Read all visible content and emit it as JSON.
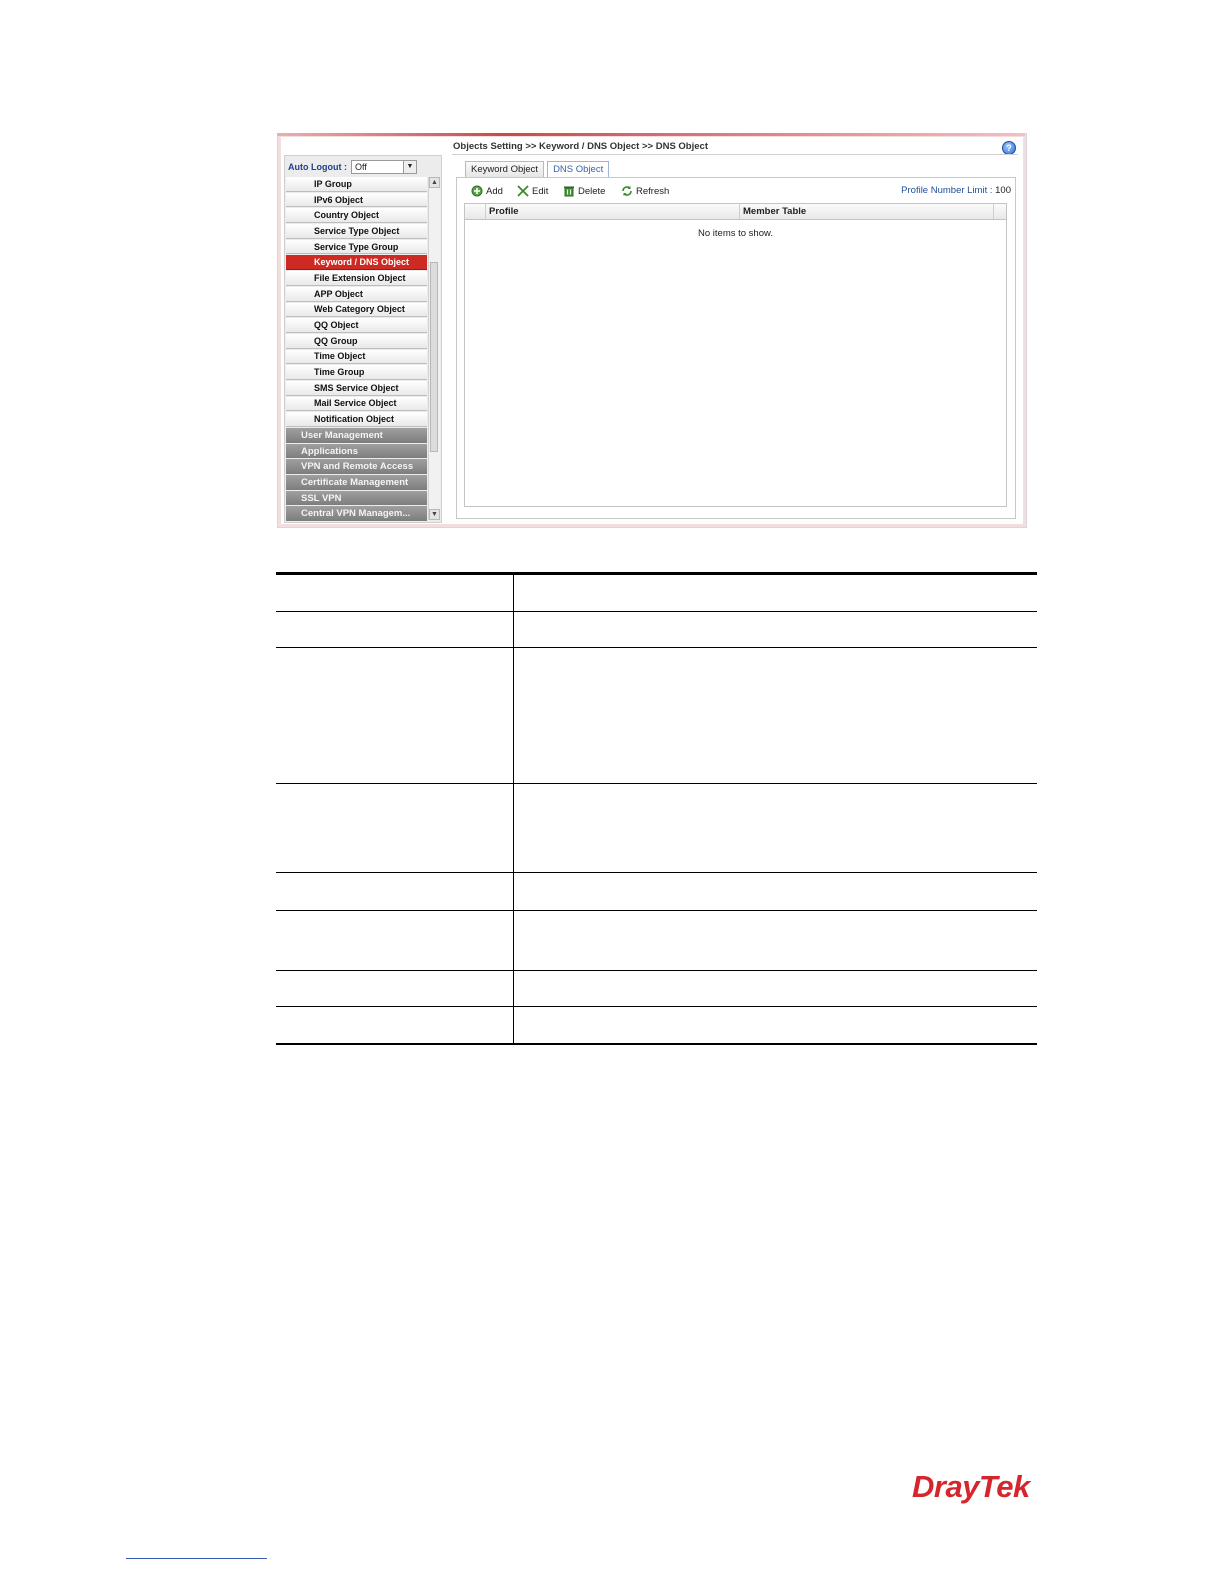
{
  "sidebar": {
    "auto_logout_label": "Auto Logout :",
    "auto_logout_value": "Off",
    "items": [
      {
        "label": "IP Group"
      },
      {
        "label": "IPv6 Object"
      },
      {
        "label": "Country Object"
      },
      {
        "label": "Service Type Object"
      },
      {
        "label": "Service Type Group"
      },
      {
        "label": "Keyword / DNS Object",
        "active": true
      },
      {
        "label": "File Extension Object"
      },
      {
        "label": "APP Object"
      },
      {
        "label": "Web Category Object"
      },
      {
        "label": "QQ Object"
      },
      {
        "label": "QQ Group"
      },
      {
        "label": "Time Object"
      },
      {
        "label": "Time Group"
      },
      {
        "label": "SMS Service Object"
      },
      {
        "label": "Mail Service Object"
      },
      {
        "label": "Notification Object"
      }
    ],
    "categories": [
      {
        "label": "User Management"
      },
      {
        "label": "Applications"
      },
      {
        "label": "VPN and Remote Access"
      },
      {
        "label": "Certificate Management"
      },
      {
        "label": "SSL VPN"
      },
      {
        "label": "Central VPN Managem..."
      }
    ]
  },
  "main": {
    "breadcrumb": "Objects Setting >> Keyword / DNS Object >> DNS Object",
    "help_glyph": "?",
    "tabs": [
      {
        "label": "Keyword Object",
        "active": false
      },
      {
        "label": "DNS Object",
        "active": true
      }
    ],
    "toolbar": {
      "add": "Add",
      "edit": "Edit",
      "delete": "Delete",
      "refresh": "Refresh",
      "limit_label": "Profile Number Limit :",
      "limit_value": "100"
    },
    "grid": {
      "columns": [
        "Profile",
        "Member Table"
      ],
      "empty_text": "No items to show."
    }
  },
  "footer": {
    "logo_text": "DrayTek"
  },
  "colors": {
    "accent_red": "#cc2a22",
    "link_blue": "#1f4e99",
    "logo_red": "#d4262c"
  }
}
